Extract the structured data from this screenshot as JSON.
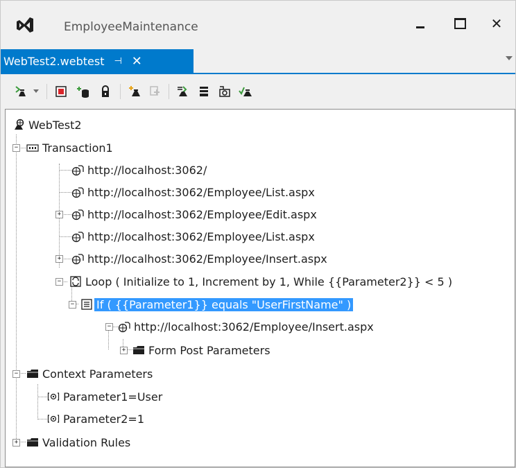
{
  "window": {
    "app_title": "EmployeeMaintenance",
    "close_glyph": "✕"
  },
  "tab": {
    "label": "WebTest2.webtest",
    "pin_glyph": "⊣",
    "close_glyph": "✕"
  },
  "toolbar": {
    "buttons": [
      "add-web-test-plugin-icon",
      "stop-icon",
      "add-data-source-icon",
      "lock-icon",
      "parameterize-icon",
      "create-performance-session-icon",
      "add-request-plugin-icon",
      "set-request-details-icon",
      "extract-parameter-icon",
      "run-test-icon"
    ]
  },
  "tree": {
    "root": "WebTest2",
    "transaction": "Transaction1",
    "requests": [
      "http://localhost:3062/",
      "http://localhost:3062/Employee/List.aspx",
      "http://localhost:3062/Employee/Edit.aspx",
      "http://localhost:3062/Employee/List.aspx",
      "http://localhost:3062/Employee/Insert.aspx"
    ],
    "loop": "Loop ( Initialize to 1, Increment by 1, While {{Parameter2}} < 5 )",
    "condition": "If ( {{Parameter1}} equals \"UserFirstName\" )",
    "inner_request": "http://localhost:3062/Employee/Insert.aspx",
    "form_post": "Form Post Parameters",
    "context": "Context Parameters",
    "param1": "Parameter1=User",
    "param2": "Parameter2=1",
    "validation": "Validation Rules"
  },
  "colors": {
    "accent": "#007acc",
    "selection": "#3399ff"
  }
}
